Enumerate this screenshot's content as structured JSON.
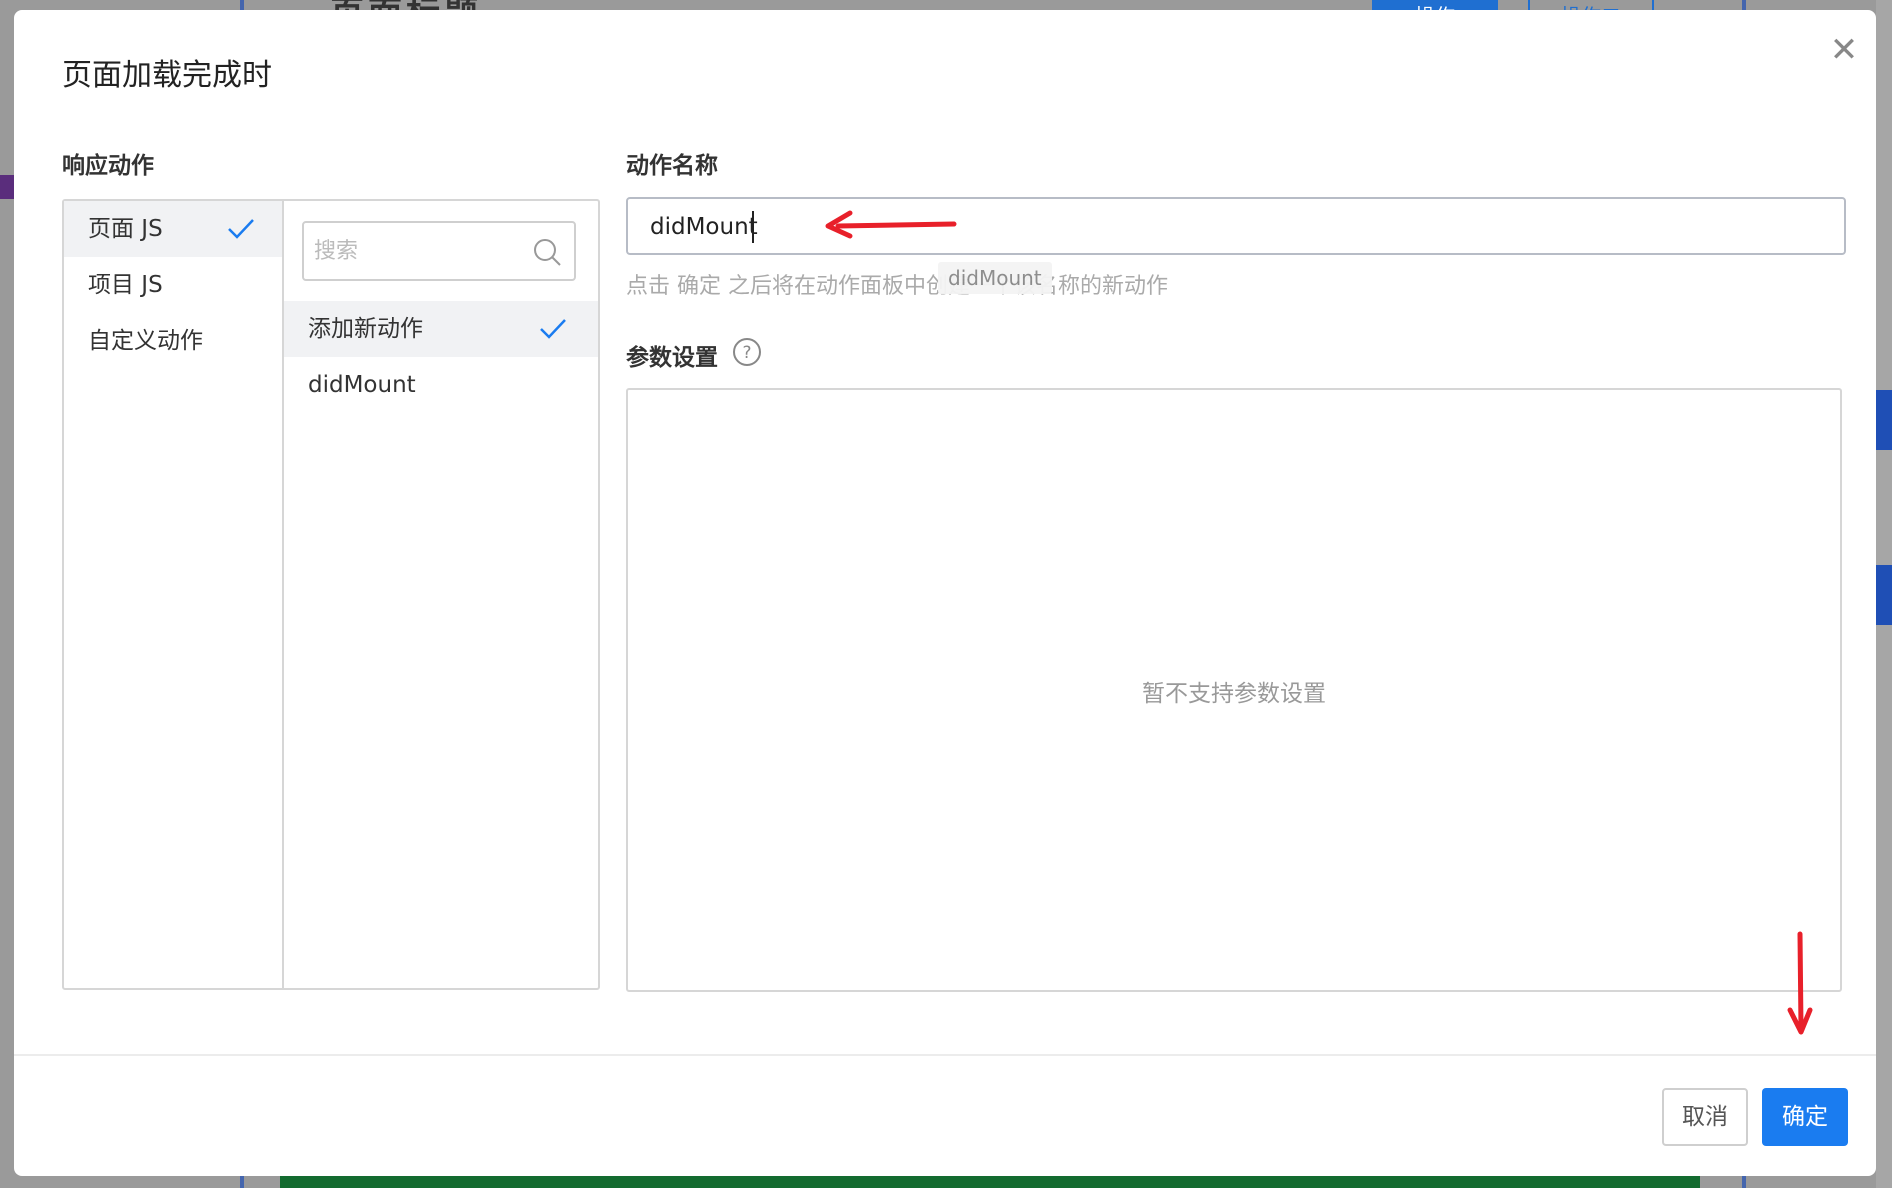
{
  "background": {
    "page_title": "页面标题",
    "button_1": "操作",
    "button_2": "操作二"
  },
  "modal": {
    "title": "页面加载完成时",
    "close_icon": "close-icon"
  },
  "response_actions": {
    "label": "响应动作",
    "categories": [
      {
        "label": "页面 JS",
        "selected": true
      },
      {
        "label": "项目 JS",
        "selected": false
      },
      {
        "label": "自定义动作",
        "selected": false
      }
    ],
    "search": {
      "placeholder": "搜索",
      "value": ""
    },
    "actions": [
      {
        "label": "添加新动作",
        "selected": true
      },
      {
        "label": "didMount",
        "selected": false
      }
    ]
  },
  "action_name": {
    "label": "动作名称",
    "value": "didMount",
    "hint": "点击 确定 之后将在动作面板中创建一个该名称的新动作",
    "hint_tooltip": "didMount"
  },
  "params": {
    "label": "参数设置",
    "empty_text": "暂不支持参数设置"
  },
  "footer": {
    "cancel_label": "取消",
    "ok_label": "确定"
  },
  "colors": {
    "accent": "#1a7cf0",
    "annotation_arrow": "#e8202a"
  }
}
